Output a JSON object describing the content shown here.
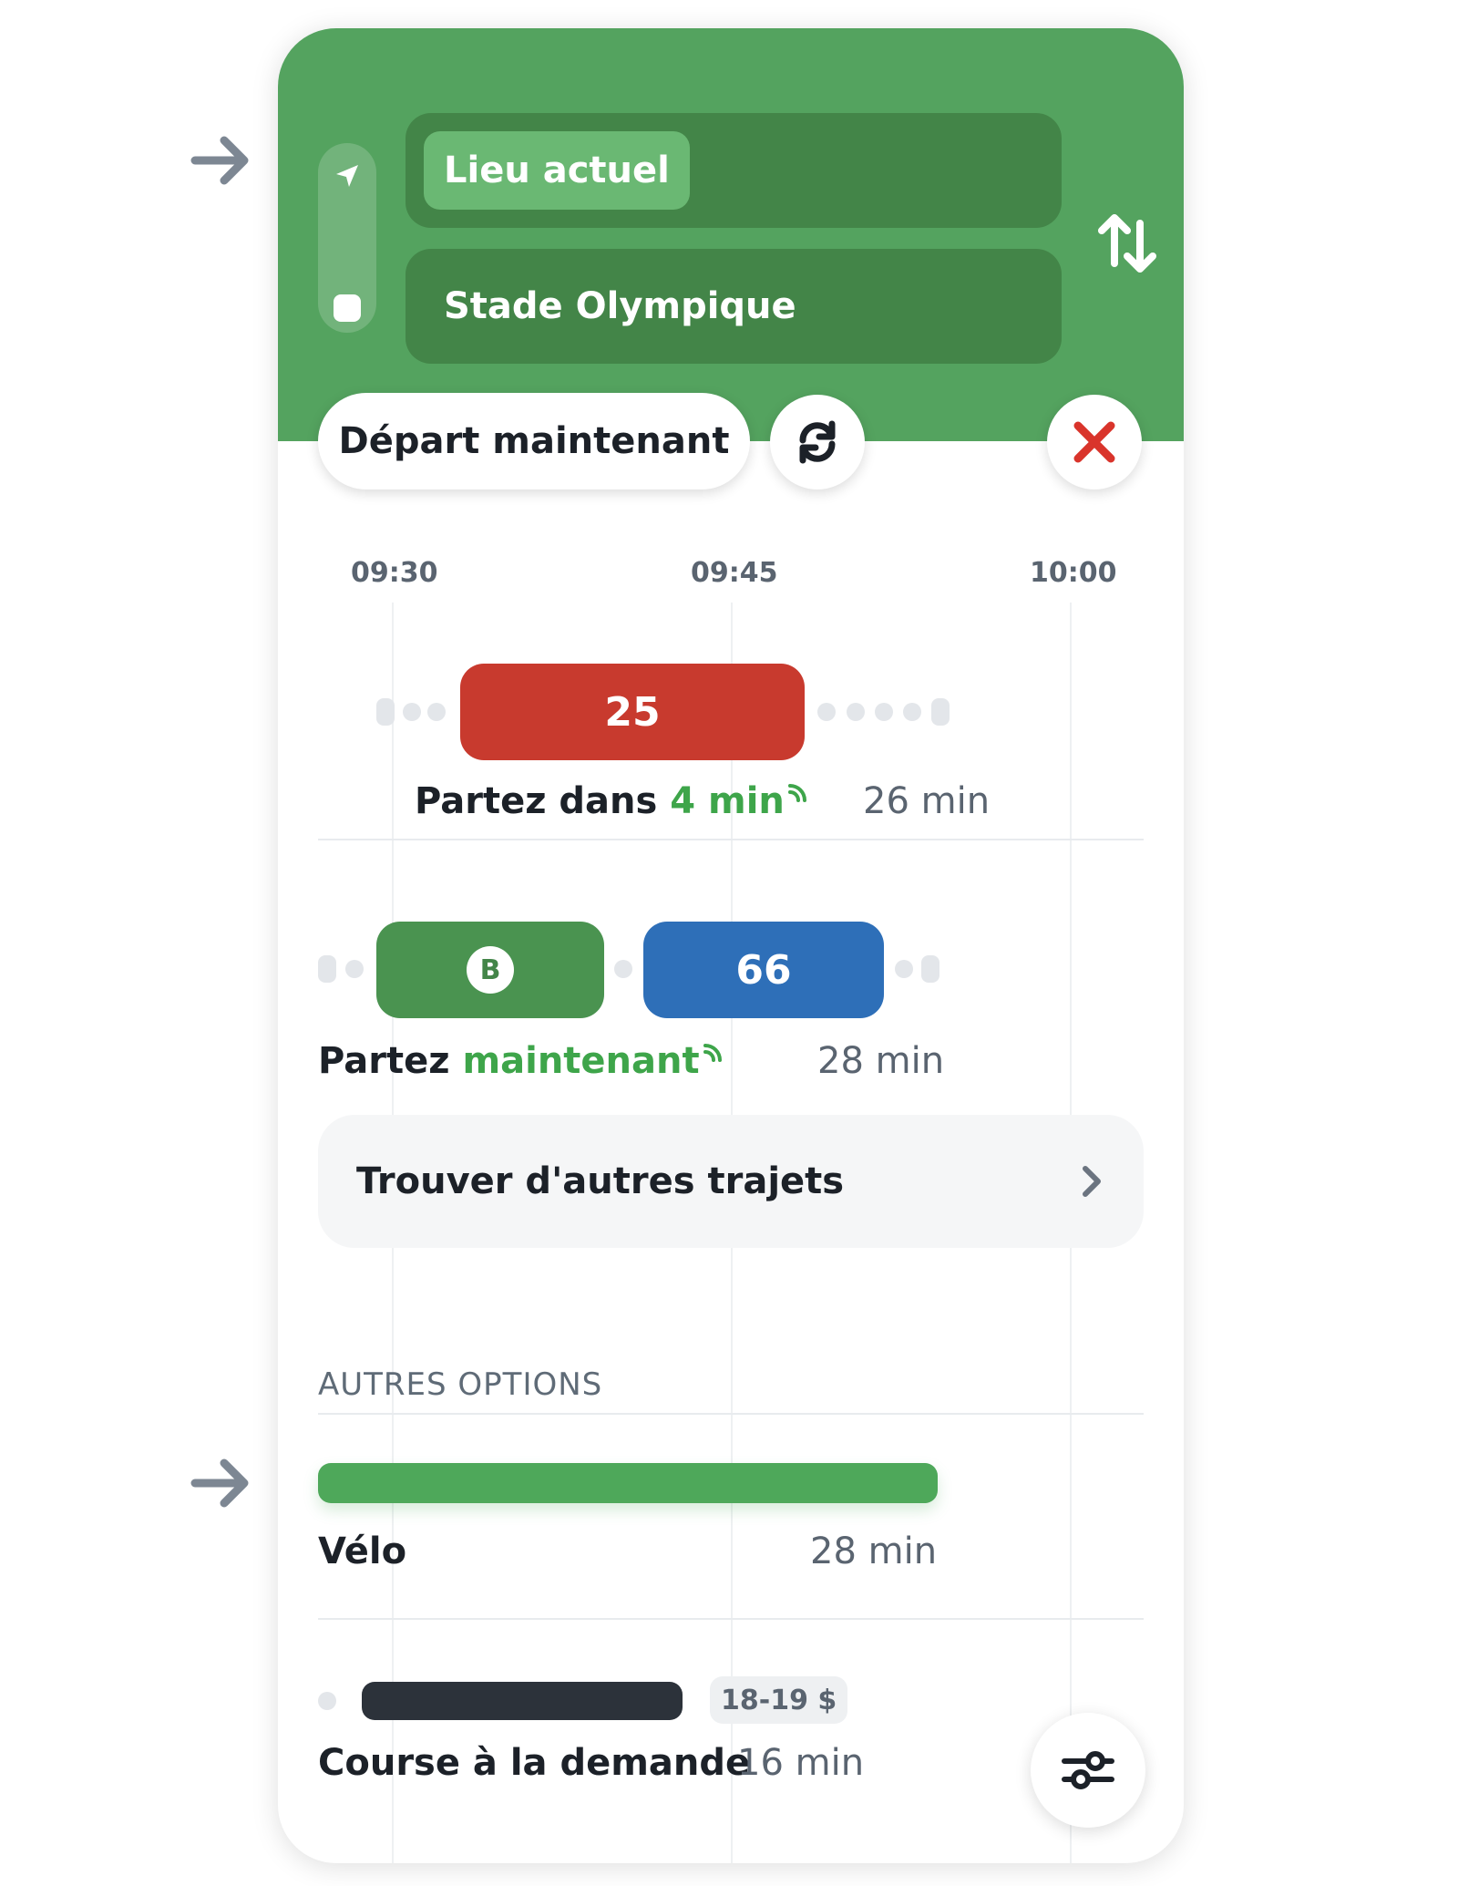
{
  "search": {
    "origin_chip": "Lieu actuel",
    "destination": "Stade Olympique",
    "depart_label": "Départ maintenant"
  },
  "timeline": {
    "ticks": [
      "09:30",
      "09:45",
      "10:00"
    ]
  },
  "routes": [
    {
      "line": "25",
      "line_color": "#c83a2e",
      "title_prefix": "Partez dans",
      "title_highlight": "4 min",
      "duration": "26 min",
      "realtime": true
    },
    {
      "metro_badge": "B",
      "metro_color": "#4a9350",
      "line": "66",
      "line_color": "#2e6fb8",
      "title_prefix": "Partez",
      "title_highlight": "maintenant",
      "duration": "28 min",
      "realtime": true
    }
  ],
  "more_trips": {
    "label": "Trouver d'autres trajets"
  },
  "other_options": {
    "heading": "AUTRES OPTIONS",
    "items": [
      {
        "label": "Vélo",
        "duration": "28 min",
        "bar_color": "#4ea85a"
      },
      {
        "label": "Course à la demande",
        "duration": "16 min",
        "price": "18-19 $",
        "bar_color": "#2c323a"
      }
    ]
  },
  "colors": {
    "header": "#54a35f",
    "accent_green": "#3ea54a",
    "close_red": "#d9342b"
  },
  "icons": {
    "navigation": "navigation-arrow-icon",
    "destination": "square-stop-icon",
    "swap": "swap-arrows-icon",
    "refresh": "refresh-icon",
    "close": "close-icon",
    "realtime": "realtime-signal-icon",
    "chevron": "chevron-right-icon",
    "filter": "sliders-icon",
    "pointer": "pointer-arrow-icon"
  }
}
